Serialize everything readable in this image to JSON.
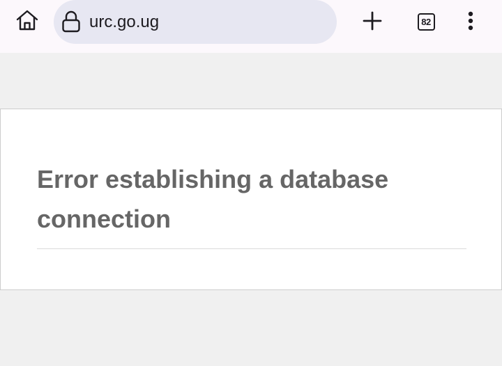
{
  "browser": {
    "url": "urc.go.ug",
    "tab_count": "82",
    "icons": {
      "home": "home-icon",
      "lock": "lock-icon",
      "new_tab": "plus-icon",
      "tabs": "tab-switcher-icon",
      "menu": "more-vert-icon"
    },
    "colors": {
      "toolbar_bg": "#fcf8fc",
      "url_bar_bg": "#e7e7f2",
      "page_bg": "#f0f0f0"
    }
  },
  "page": {
    "error_heading": "Error establishing a database connection",
    "colors": {
      "heading_text": "#666666",
      "card_bg": "#ffffff"
    }
  }
}
